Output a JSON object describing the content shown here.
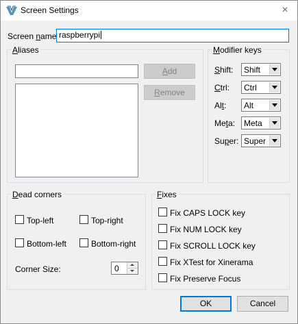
{
  "window": {
    "title": "Screen Settings",
    "close_glyph": "×",
    "icon": "synergy-app-icon"
  },
  "screen_name": {
    "label_pre": "Screen ",
    "label_u": "n",
    "label_post": "ame:",
    "value": "raspberrypi"
  },
  "aliases": {
    "title_pre": "",
    "title_u": "A",
    "title_post": "liases",
    "input_value": "",
    "add_pre": "",
    "add_u": "A",
    "add_post": "dd",
    "remove_pre": "",
    "remove_u": "R",
    "remove_post": "emove"
  },
  "modifier_keys": {
    "title_pre": "",
    "title_u": "M",
    "title_post": "odifier keys",
    "rows": [
      {
        "pre": "",
        "u": "S",
        "post": "hift:",
        "value": "Shift"
      },
      {
        "pre": "",
        "u": "C",
        "post": "trl:",
        "value": "Ctrl"
      },
      {
        "pre": "Al",
        "u": "t",
        "post": ":",
        "value": "Alt"
      },
      {
        "pre": "Me",
        "u": "t",
        "post": "a:",
        "value": "Meta"
      },
      {
        "pre": "Su",
        "u": "p",
        "post": "er:",
        "value": "Super"
      }
    ]
  },
  "dead_corners": {
    "title_pre": "",
    "title_u": "D",
    "title_post": "ead corners",
    "top_left": "Top-left",
    "top_right": "Top-right",
    "bottom_left": "Bottom-left",
    "bottom_right": "Bottom-right",
    "corner_size_label": "Corner Size:",
    "corner_size_value": "0"
  },
  "fixes": {
    "title_pre": "",
    "title_u": "F",
    "title_post": "ixes",
    "items": [
      "Fix CAPS LOCK key",
      "Fix NUM LOCK key",
      "Fix SCROLL LOCK key",
      "Fix XTest for Xinerama",
      "Fix Preserve Focus"
    ]
  },
  "buttons": {
    "ok": "OK",
    "cancel": "Cancel"
  }
}
